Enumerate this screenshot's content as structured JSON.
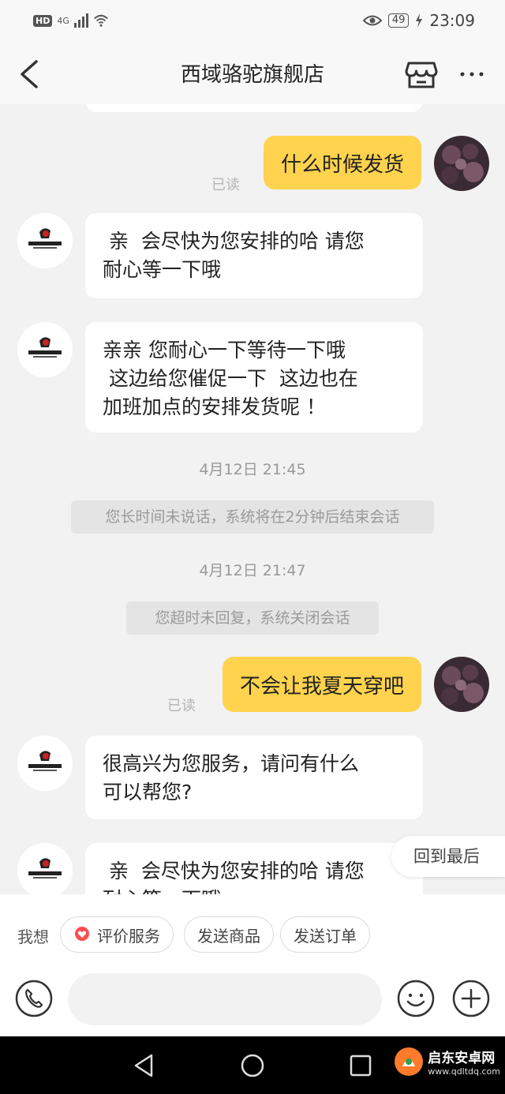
{
  "status_bar": {
    "hd": "HD",
    "network": "4G",
    "battery": "49",
    "time": "23:09"
  },
  "nav": {
    "title": "西域骆驼旗舰店"
  },
  "chat": {
    "read_label": "已读",
    "messages": [
      {
        "text": "什么时候发货"
      },
      {
        "text": " 亲  会尽快为您安排的哈 请您\n耐心等一下哦"
      },
      {
        "text": "亲亲 您耐心一下等待一下哦\n 这边给您催促一下  这边也在\n加班加点的安排发货呢 ！"
      },
      {
        "text": "4月12日 21:45"
      },
      {
        "text": "您长时间未说话，系统将在2分钟后结束会话"
      },
      {
        "text": "4月12日 21:47"
      },
      {
        "text": "您超时未回复，系统关闭会话"
      },
      {
        "text": "不会让我夏天穿吧"
      },
      {
        "text": "很高兴为您服务，请问有什么\n可以帮您?"
      },
      {
        "text": " 亲  会尽快为您安排的哈 请您\n耐心等一下哦"
      }
    ],
    "jump_to_latest": "回到最后"
  },
  "quick_actions": {
    "label": "我想",
    "items": [
      {
        "label": "评价服务",
        "icon": "heart-chat-icon"
      },
      {
        "label": "发送商品"
      },
      {
        "label": "发送订单"
      }
    ]
  },
  "input": {
    "placeholder": ""
  },
  "watermark": {
    "name": "启东安卓网",
    "url": "www.qdltdq.com"
  },
  "colors": {
    "accent": "#ffd34d",
    "chip_icon": "#ff4d4f",
    "background": "#f2f2f2"
  }
}
